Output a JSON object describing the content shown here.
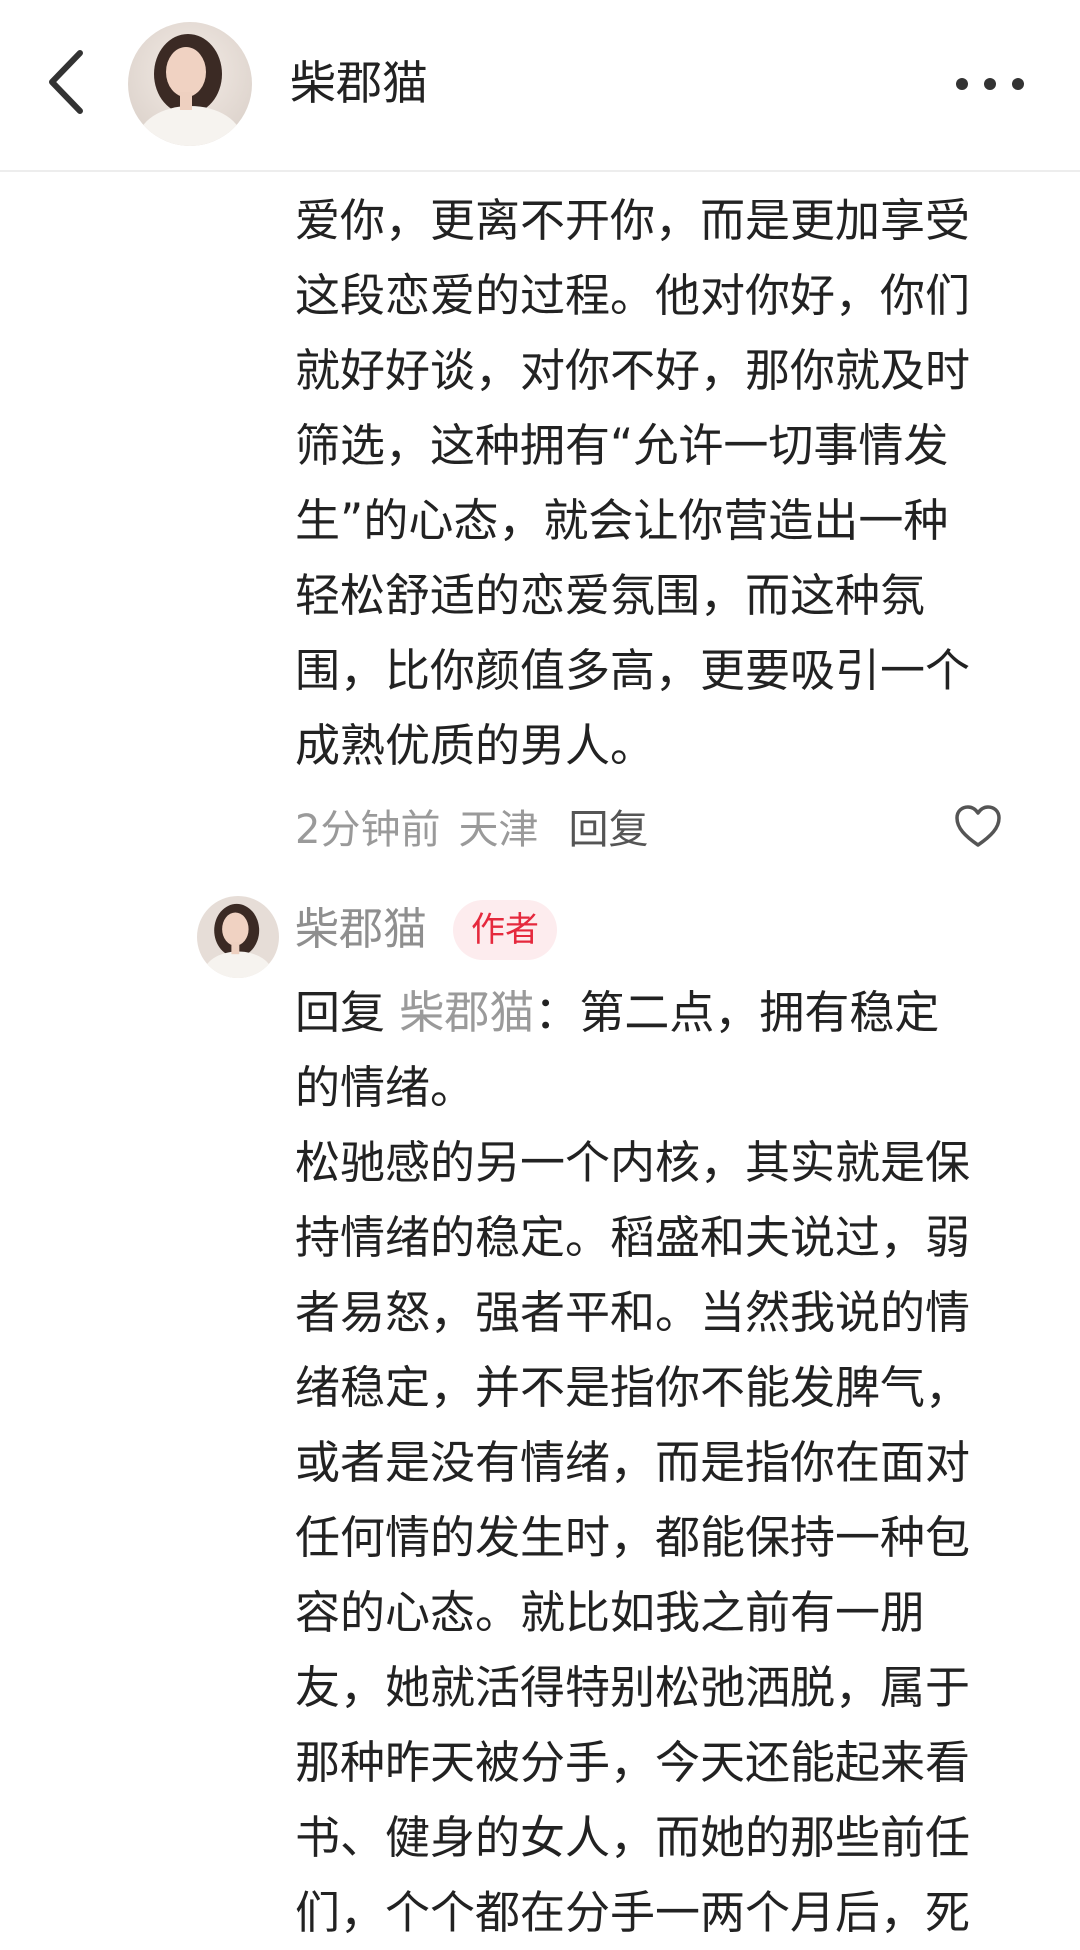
{
  "header": {
    "back_icon": "chevron-left-icon",
    "username": "柴郡猫",
    "more_icon": "more-horizontal-icon"
  },
  "comment": {
    "lines": [
      "爱你，更离不开你，而是更加享受",
      "这段恋爱的过程。他对你好，你们",
      "就好好谈，对你不好，那你就及时",
      "筛选，这种拥有“允许一切事情发",
      "生”的心态，就会让你营造出一种",
      "轻松舒适的恋爱氛围，而这种氛",
      "围，比你颜值多高，更要吸引一个",
      "成熟优质的男人。"
    ],
    "time": "2分钟前",
    "location": "天津",
    "reply_label": "回复",
    "like_icon": "heart-outline-icon"
  },
  "reply": {
    "author": "柴郡猫",
    "badge": "作者",
    "prefix": "回复",
    "to_name": "柴郡猫",
    "first_line_rest": "：第二点，拥有稳定",
    "lines": [
      "的情绪。",
      "松驰感的另一个内核，其实就是保",
      "持情绪的稳定。稻盛和夫说过，弱",
      "者易怒，强者平和。当然我说的情",
      "绪稳定，并不是指你不能发脾气，",
      "或者是没有情绪，而是指你在面对",
      "任何情的发生时，都能保持一种包",
      "容的心态。就比如我之前有一朋",
      "友，她就活得特别松弛洒脱，属于",
      "那种昨天被分手，今天还能起来看",
      "书、健身的女人，而她的那些前任",
      "们，个个都在分手一两个月后，死"
    ]
  },
  "colors": {
    "text": "#222222",
    "muted": "#9a9a9a",
    "badge_bg": "#fdecee",
    "badge_text": "#e5293d"
  }
}
